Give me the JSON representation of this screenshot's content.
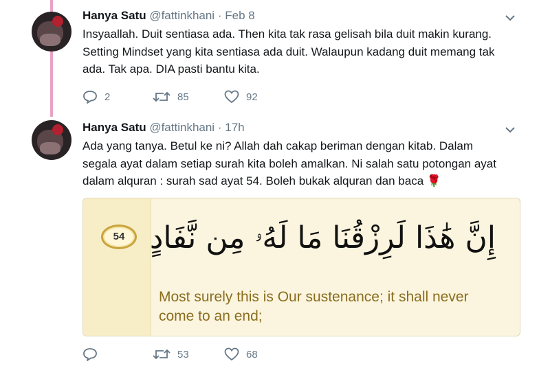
{
  "tweets": [
    {
      "name": "Hanya Satu",
      "handle": "@fattinkhani",
      "time": "Feb 8",
      "lines": [
        "Insyaallah. Duit sentiasa ada. Then kita tak rasa gelisah bila duit makin kurang.",
        "Setting Mindset yang kita sentiasa ada duit. Walaupun kadang duit memang tak",
        "ada. Tak apa. DIA pasti bantu kita."
      ],
      "replies": "2",
      "retweets": "85",
      "likes": "92"
    },
    {
      "name": "Hanya Satu",
      "handle": "@fattinkhani",
      "time": "17h",
      "lines": [
        "Ada yang tanya. Betul ke ni? Allah dah cakap beriman dengan kitab. Dalam",
        "segala ayat dalam setiap surah kita boleh amalkan. Ni salah satu potongan ayat",
        "dalam alquran : surah sad ayat 54. Boleh bukak alquran dan baca"
      ],
      "emoji": "🌹",
      "replies": "",
      "retweets": "53",
      "likes": "68"
    }
  ],
  "card": {
    "ayah_number": "54",
    "arabic": "إِنَّ هَٰذَا لَرِزْقُنَا مَا لَهُۥ مِن نَّفَادٍ",
    "translation": "Most surely this is Our sustenance; it shall never come to an end;"
  },
  "colors": {
    "thread_line": "#e8a3c4",
    "secondary_text": "#657786",
    "translation_text": "#8a6d1f"
  }
}
